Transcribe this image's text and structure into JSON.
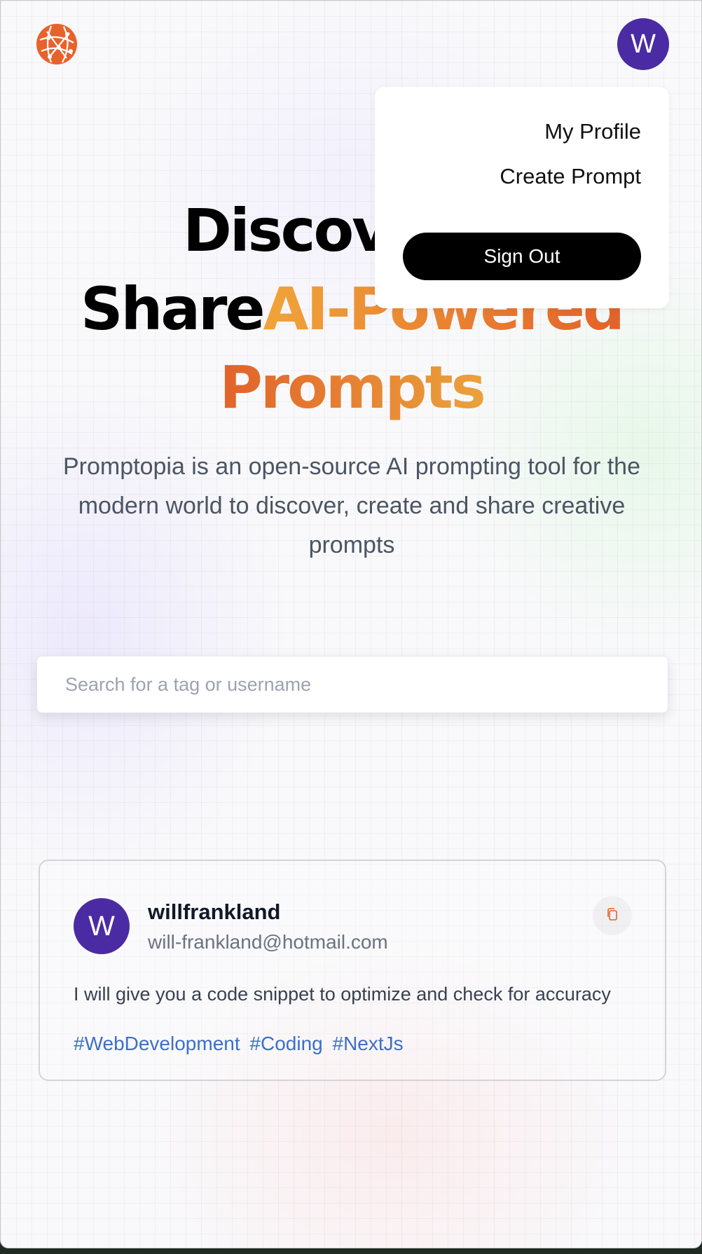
{
  "header": {
    "avatar_initial": "W"
  },
  "hero": {
    "line1": "Discover &",
    "line2_plain": "Share",
    "line2_accent": "AI-Powered",
    "line3_accent": "Prompts",
    "description": "Promptopia is an open-source AI prompting tool for the modern world to discover, create and share creative prompts"
  },
  "search": {
    "placeholder": "Search for a tag or username",
    "value": ""
  },
  "prompt_card": {
    "avatar_initial": "W",
    "username": "willfrankland",
    "email": "will-frankland@hotmail.com",
    "prompt": "I will give you a code snippet to optimize and check for accuracy",
    "tags": [
      "#WebDevelopment",
      "#Coding",
      "#NextJs"
    ]
  },
  "dropdown": {
    "my_profile": "My Profile",
    "create_prompt": "Create Prompt",
    "sign_out": "Sign Out"
  },
  "colors": {
    "brand_orange": "#e8622c",
    "avatar_purple": "#4a2ba3",
    "tag_blue": "#3b6fc9",
    "gradient_start": "#f0a43a",
    "gradient_end": "#e2622a"
  },
  "icons": {
    "logo": "globe-network-icon",
    "copy": "copy-icon"
  }
}
